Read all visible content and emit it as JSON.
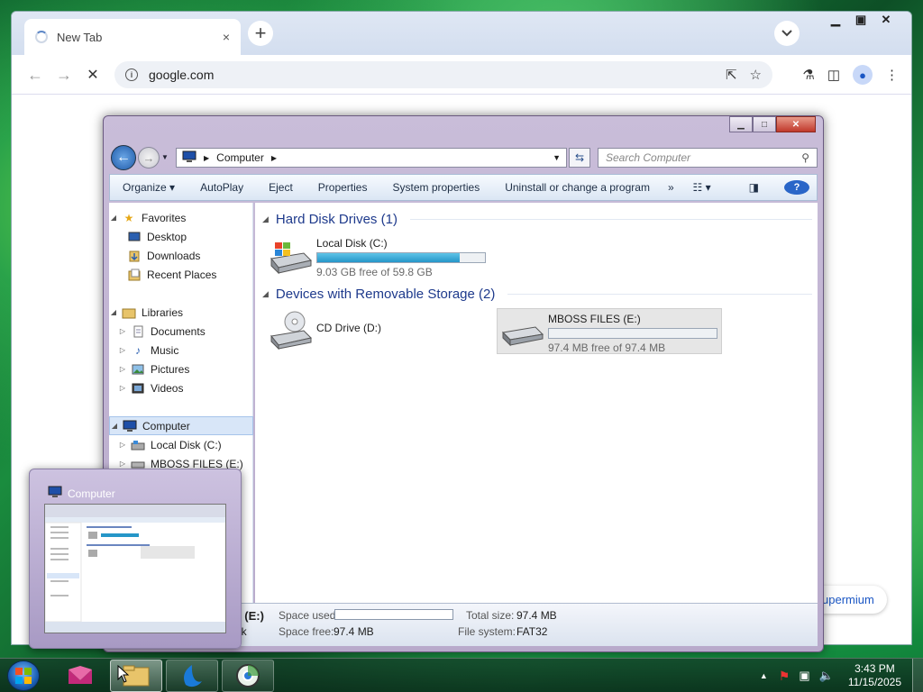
{
  "browser": {
    "tab_title": "New Tab",
    "tab_close": "×",
    "new_tab": "+",
    "address": "google.com",
    "supermium_label": "upermium"
  },
  "explorer": {
    "breadcrumb": "Computer",
    "search_placeholder": "Search Computer",
    "toolbar": [
      "Organize",
      "AutoPlay",
      "Eject",
      "Properties",
      "System properties",
      "Uninstall or change a program"
    ],
    "toolbar_more": "»",
    "nav": {
      "favorites": "Favorites",
      "desktop": "Desktop",
      "downloads": "Downloads",
      "recent_places": "Recent Places",
      "libraries": "Libraries",
      "documents": "Documents",
      "music": "Music",
      "pictures": "Pictures",
      "videos": "Videos",
      "computer": "Computer",
      "local_disk": "Local Disk (C:)",
      "mboss_files": "MBOSS FILES (E:)"
    },
    "groups": {
      "hdd": "Hard Disk Drives (1)",
      "removable": "Devices with Removable Storage (2)"
    },
    "drives": {
      "c": {
        "name": "Local Disk (C:)",
        "free": "9.03 GB free of 59.8 GB",
        "used_fraction": 0.85
      },
      "d": {
        "name": "CD Drive (D:)"
      },
      "e": {
        "name": "MBOSS FILES (E:)",
        "free": "97.4 MB free of 97.4 MB",
        "used_fraction": 0.0
      }
    },
    "status": {
      "name_fragment": "S (E:)",
      "type_fragment": "isk",
      "space_used_label": "Space used:",
      "space_free_label": "Space free:",
      "space_free_value": "97.4 MB",
      "total_size_label": "Total size:",
      "total_size_value": "97.4 MB",
      "fs_label": "File system:",
      "fs_value": "FAT32"
    }
  },
  "thumbnail": {
    "title": "Computer"
  },
  "taskbar": {
    "time": "3:43 PM",
    "date": "11/15/2025"
  },
  "colors": {
    "accent": "#1e3a8c",
    "drive_bar": "#2596c8",
    "close_red": "#c0392b"
  }
}
